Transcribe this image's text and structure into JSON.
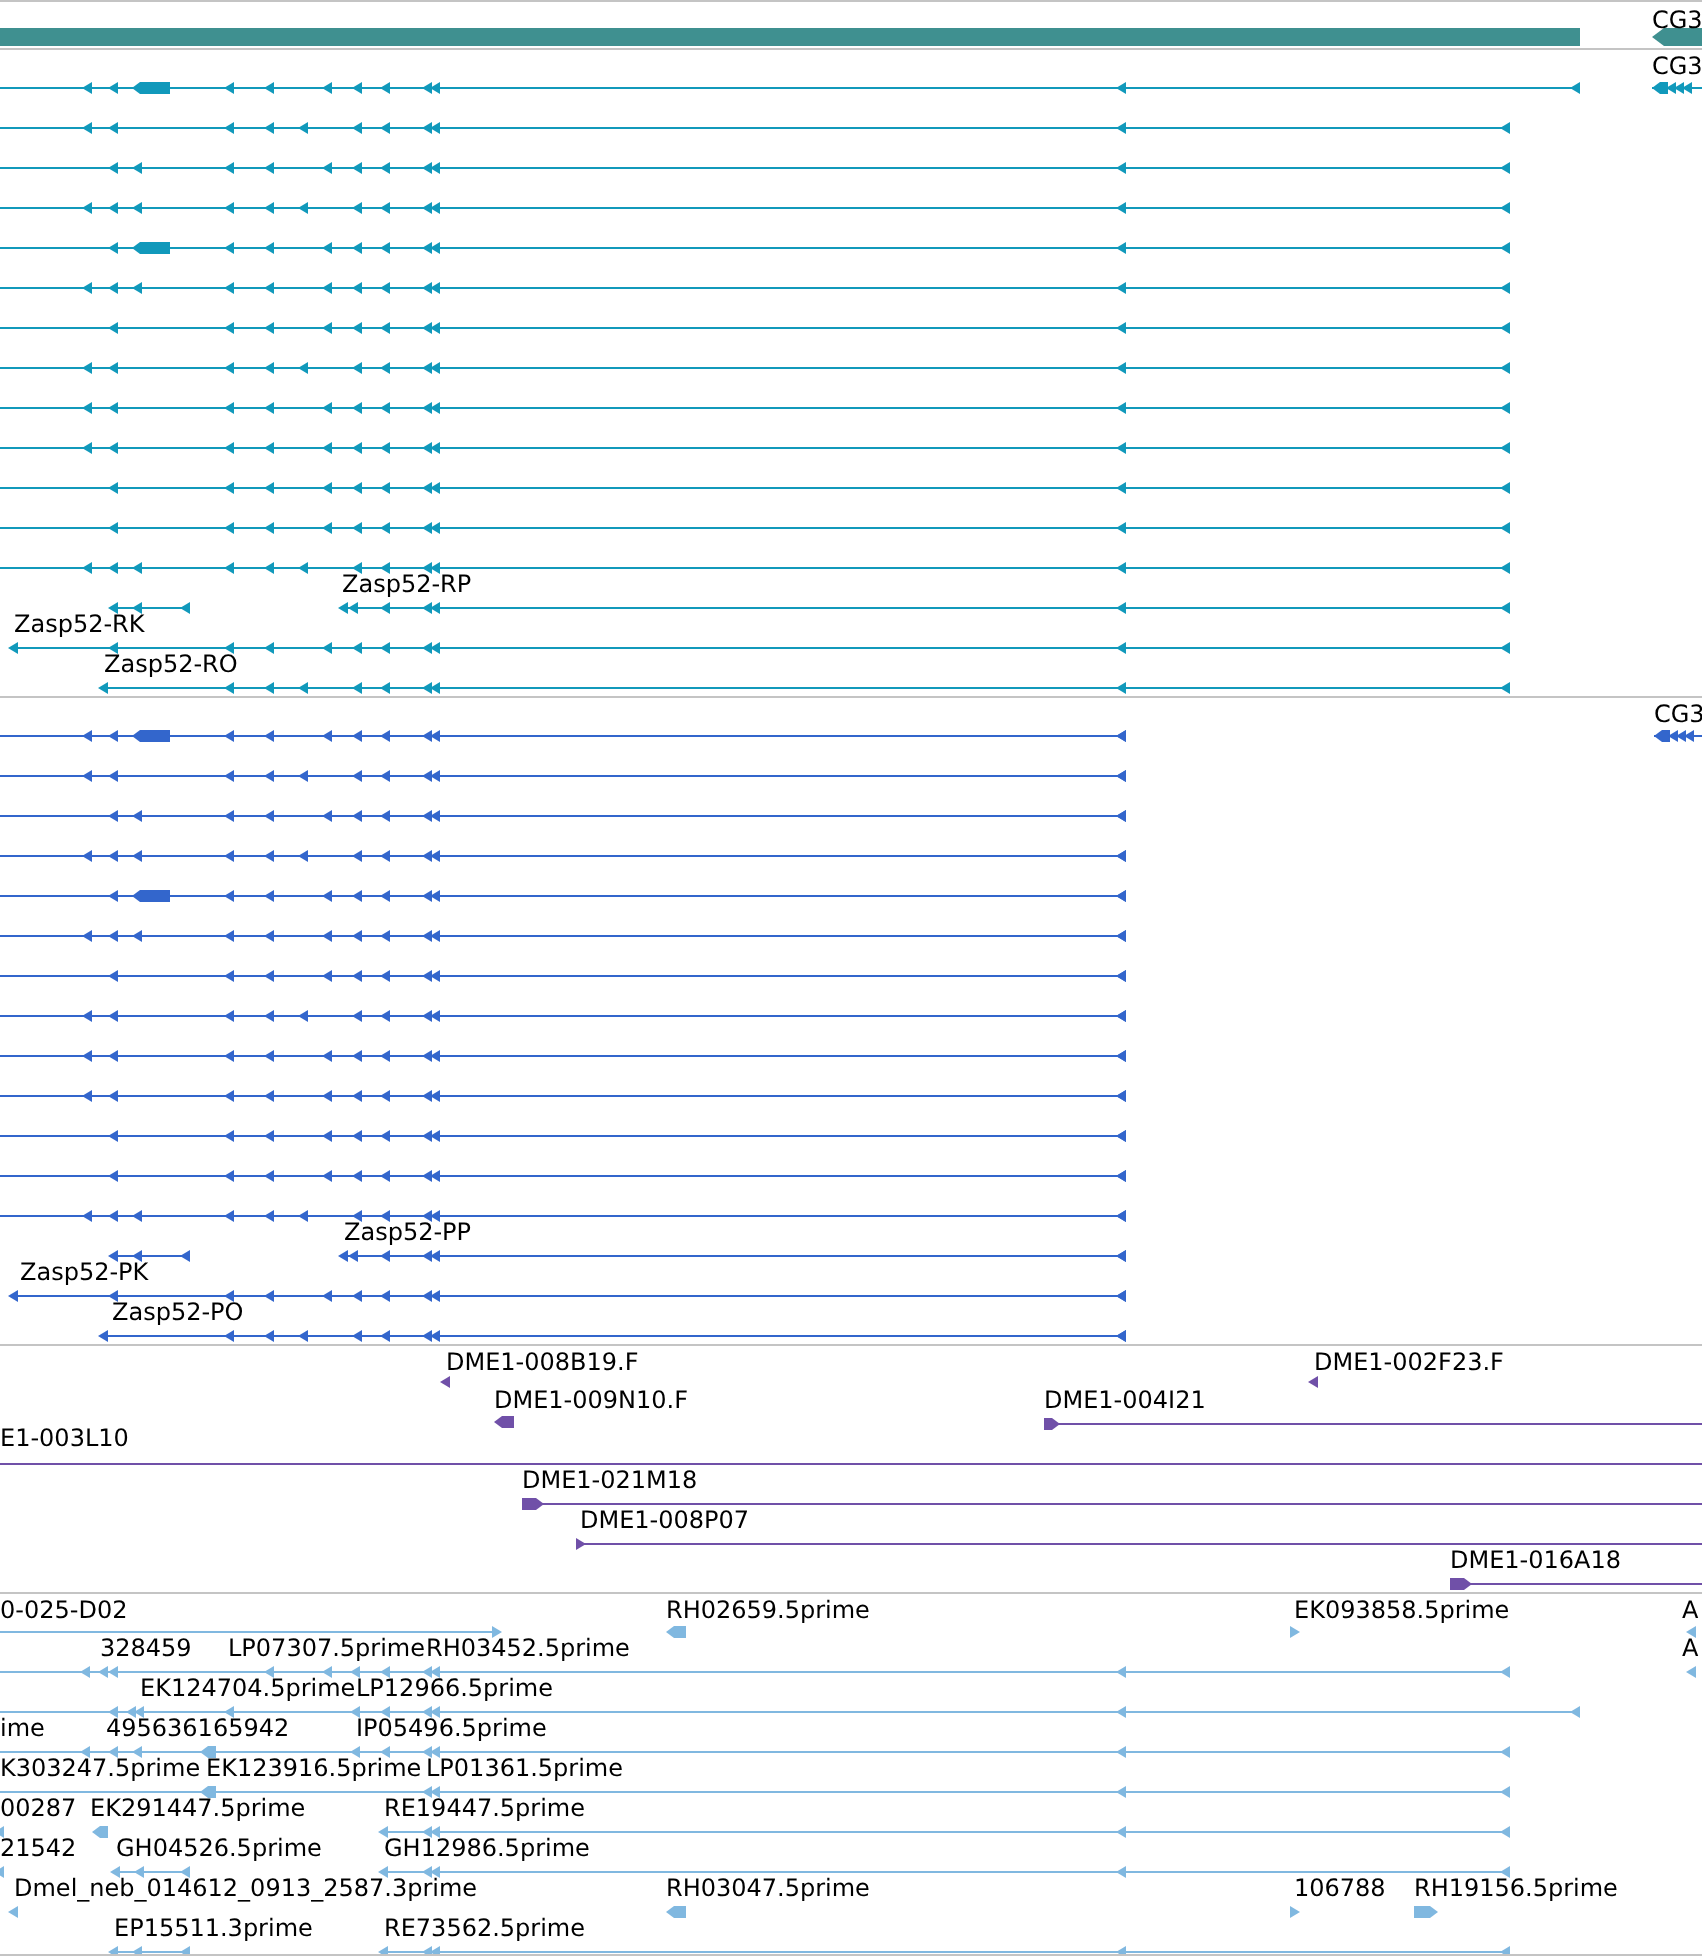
{
  "tracks": [
    {
      "kind": "gene",
      "color": "#3f9090",
      "labels": [
        "CG3"
      ]
    },
    {
      "kind": "transcript",
      "color": "#1199bb",
      "labels": [
        "CG3",
        "Zasp52-RP",
        "Zasp52-RK",
        "Zasp52-RO"
      ]
    },
    {
      "kind": "transcript",
      "color": "#3366cc",
      "labels": [
        "CG3",
        "Zasp52-PP",
        "Zasp52-PK",
        "Zasp52-PO"
      ]
    },
    {
      "kind": "clone",
      "color": "#7050a8",
      "labels": [
        "DME1-008B19.F",
        "DME1-002F23.F",
        "DME1-009N10.F",
        "DME1-004I21",
        "E1-003L10",
        "DME1-021M18",
        "DME1-008P07",
        "DME1-016A18"
      ]
    },
    {
      "kind": "est",
      "color": "#80b8e0",
      "labels": [
        "0-025-D02",
        "RH02659.5prime",
        "EK093858.5prime",
        "A",
        "328459",
        "LP07307.5prime",
        "RH03452.5prime",
        "A",
        "EK124704.5prime",
        "LP12966.5prime",
        "ime",
        "495636165942",
        "IP05496.5prime",
        "K303247.5prime",
        "EK123916.5prime",
        "LP01361.5prime",
        "00287",
        "EK291447.5prime",
        "RE19447.5prime",
        "21542",
        "GH04526.5prime",
        "GH12986.5prime",
        "Dmel_neb_014612_0913_2587.3prime",
        "RH03047.5prime",
        "106788",
        "RH19156.5prime",
        "EP15511.3prime",
        "RE73562.5prime"
      ]
    }
  ]
}
